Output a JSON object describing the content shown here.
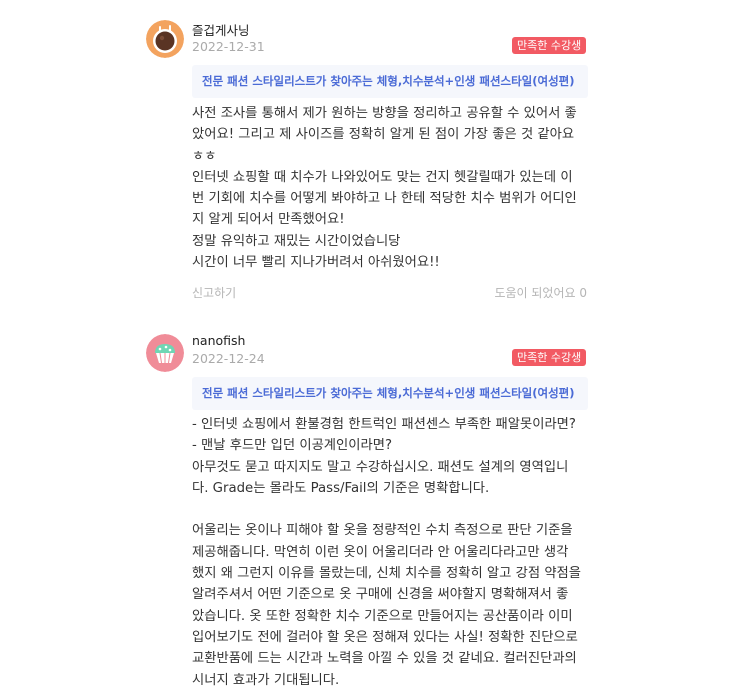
{
  "reviews": [
    {
      "author": "즐겁게사닝",
      "date": "2022-12-31",
      "badge": "만족한 수강생",
      "course": "전문 패션 스타일리스트가 찾아주는 체형,치수분석+인생 패션스타일(여성편)",
      "body": "사전 조사를 통해서 제가 원하는 방향을 정리하고 공유할 수 있어서 좋\n았어요! 그리고 제 사이즈를 정확히 알게 된 점이 가장 좋은 것 같아요\nㅎㅎ\n인터넷 쇼핑할 때 치수가 나와있어도 맞는 건지 헷갈릴때가 있는데 이\n번 기회에 치수를 어떻게 봐야하고 나 한테 적당한 치수 범위가 어디인\n지 알게 되어서 만족했어요!\n정말 유익하고 재밌는 시간이었습니당\n시간이 너무 빨리 지나가버려서 아쉬웠어요!!",
      "report_label": "신고하기",
      "helpful_label": "도움이 되었어요 0",
      "avatar_icon": "coffee-cup-avatar-icon"
    },
    {
      "author": "nanofish",
      "date": "2022-12-24",
      "badge": "만족한 수강생",
      "course": "전문 패션 스타일리스트가 찾아주는 체형,치수분석+인생 패션스타일(여성편)",
      "body": "- 인터넷 쇼핑에서 환불경험 한트럭인 패션센스 부족한 패알못이라면?\n- 맨날 후드만 입던 이공계인이라면?\n아무것도 묻고 따지지도 말고 수강하십시오. 패션도 설계의 영역입니\n다. Grade는 몰라도 Pass/Fail의 기준은 명확합니다.\n\n어울리는 옷이나 피해야 할 옷을 정량적인 수치 측정으로 판단 기준을\n제공해줍니다. 막연히 이런 옷이 어울리더라 안 어울리다라고만 생각\n했지 왜 그런지 이유를 몰랐는데, 신체 치수를 정확히 알고 강점 약점을\n알려주셔서 어떤 기준으로 옷 구매에 신경을 써야할지 명확해져서 좋\n았습니다. 옷 또한 정확한 치수 기준으로 만들어지는 공산품이라 이미\n입어보기도 전에 걸러야 할 옷은 정해져 있다는 사실! 정확한 진단으로\n교환반품에 드는 시간과 노력을 아낄 수 있을 것 같네요. 컬러진단과의\n시너지 효과가 기대됩니다.",
      "avatar_icon": "cupcake-avatar-icon"
    }
  ],
  "colors": {
    "badge": "#f25a63",
    "course_link": "#4b6bd6",
    "course_bg": "#f5f7fc"
  }
}
